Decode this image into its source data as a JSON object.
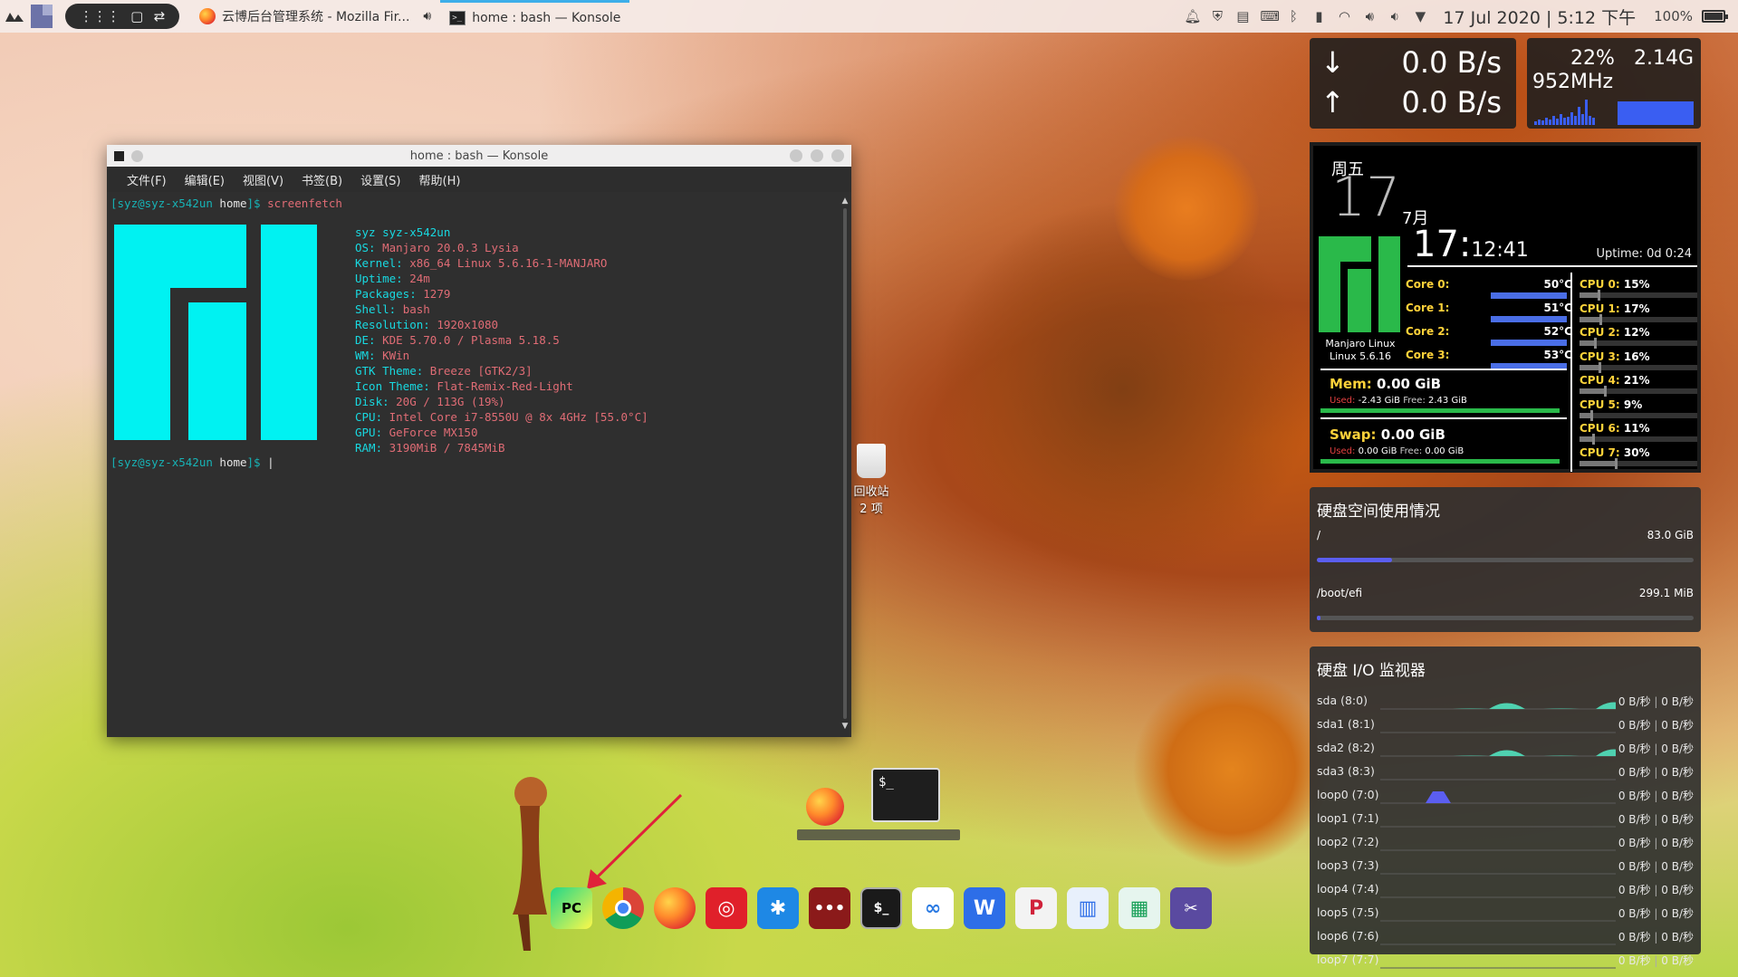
{
  "panel": {
    "tasks": [
      {
        "title": "云博后台管理系统 - Mozilla Fir...",
        "icon": "firefox-icon"
      },
      {
        "title": "home : bash — Konsole",
        "icon": "konsole-icon"
      }
    ],
    "clock": "17 Jul 2020 | 5:12 下午",
    "battery": "100%",
    "battery_level": 1.0
  },
  "konsole": {
    "title": "home : bash — Konsole",
    "menu": [
      "文件(F)",
      "编辑(E)",
      "视图(V)",
      "书签(B)",
      "设置(S)",
      "帮助(H)"
    ],
    "prompt_user": "[syz@syz-x542un",
    "prompt_dir": " home",
    "prompt_end": "]$ ",
    "command": "screenfetch",
    "info": [
      {
        "key": "",
        "val": "syz syz-x542un"
      },
      {
        "key": "OS: ",
        "val": "Manjaro 20.0.3 Lysia"
      },
      {
        "key": "Kernel: ",
        "val": "x86_64 Linux 5.6.16-1-MANJARO"
      },
      {
        "key": "Uptime: ",
        "val": "24m"
      },
      {
        "key": "Packages: ",
        "val": "1279"
      },
      {
        "key": "Shell: ",
        "val": "bash"
      },
      {
        "key": "Resolution: ",
        "val": "1920x1080"
      },
      {
        "key": "DE: ",
        "val": "KDE 5.70.0 / Plasma 5.18.5"
      },
      {
        "key": "WM: ",
        "val": "KWin"
      },
      {
        "key": "GTK Theme: ",
        "val": "Breeze [GTK2/3]"
      },
      {
        "key": "Icon Theme: ",
        "val": "Flat-Remix-Red-Light"
      },
      {
        "key": "Disk: ",
        "val": "20G / 113G (19%)"
      },
      {
        "key": "CPU: ",
        "val": "Intel Core i7-8550U @ 8x 4GHz [55.0°C]"
      },
      {
        "key": "GPU: ",
        "val": "GeForce MX150"
      },
      {
        "key": "RAM: ",
        "val": "3190MiB / 7845MiB"
      }
    ]
  },
  "desktop": {
    "trash_label": "回收站",
    "trash_count": "2 项"
  },
  "dock": {
    "items": [
      "pycharm-icon",
      "chrome-icon",
      "firefox-icon",
      "netease-music-icon",
      "xmind-icon",
      "chat-icon",
      "terminal-icon",
      "baidu-netdisk-icon",
      "wps-writer-icon",
      "wps-pdf-icon",
      "wps-doc-icon",
      "wps-sheet-icon",
      "screenshot-icon"
    ],
    "preview_terminal": "$_"
  },
  "network": {
    "down": "0.0 B/s",
    "up": "0.0 B/s"
  },
  "cpu_widget": {
    "percent": "22%",
    "memory": "2.14G",
    "freq": "952MHz"
  },
  "conky": {
    "weekday": "周五",
    "day": "17",
    "month": "7月",
    "time_hm": "17:",
    "time_min": "12",
    "time_sec": ":41",
    "uptime": "Uptime: 0d 0:24",
    "distro": "Manjaro Linux",
    "kernel": "Linux 5.6.16",
    "cores": [
      {
        "label": "Core 0:",
        "temp": "50°C"
      },
      {
        "label": "Core 1:",
        "temp": "51°C"
      },
      {
        "label": "Core 2:",
        "temp": "52°C"
      },
      {
        "label": "Core 3:",
        "temp": "53°C"
      }
    ],
    "cpus": [
      {
        "label": "CPU 0:",
        "pct": "15%",
        "v": 15
      },
      {
        "label": "CPU 1:",
        "pct": "17%",
        "v": 17
      },
      {
        "label": "CPU 2:",
        "pct": "12%",
        "v": 12
      },
      {
        "label": "CPU 3:",
        "pct": "16%",
        "v": 16
      },
      {
        "label": "CPU 4:",
        "pct": "21%",
        "v": 21
      },
      {
        "label": "CPU 5:",
        "pct": "9%",
        "v": 9
      },
      {
        "label": "CPU 6:",
        "pct": "11%",
        "v": 11
      },
      {
        "label": "CPU 7:",
        "pct": "30%",
        "v": 30
      }
    ],
    "mem_label": "Mem:",
    "mem_value": "0.00 GiB",
    "mem_used_label": "Used:",
    "mem_used": "-2.43 GiB",
    "mem_free_label": "Free:",
    "mem_free": "2.43 GiB",
    "swap_label": "Swap:",
    "swap_value": "0.00 GiB",
    "swap_used_label": "Used:",
    "swap_used": "0.00 GiB",
    "swap_free_label": "Free:",
    "swap_free": "0.00 GiB"
  },
  "disk_usage": {
    "title": "硬盘空间使用情况",
    "mounts": [
      {
        "path": "/",
        "size": "83.0 GiB",
        "fill": 0.2
      },
      {
        "path": "/boot/efi",
        "size": "299.1 MiB",
        "fill": 0.01
      }
    ]
  },
  "disk_io": {
    "title": "硬盘 I/O 监视器",
    "rows": [
      {
        "dev": "sda (8:0)",
        "read": "0 B/秒",
        "write": "0 B/秒"
      },
      {
        "dev": "sda1 (8:1)",
        "read": "0 B/秒",
        "write": "0 B/秒"
      },
      {
        "dev": "sda2 (8:2)",
        "read": "0 B/秒",
        "write": "0 B/秒"
      },
      {
        "dev": "sda3 (8:3)",
        "read": "0 B/秒",
        "write": "0 B/秒"
      },
      {
        "dev": "loop0 (7:0)",
        "read": "0 B/秒",
        "write": "0 B/秒"
      },
      {
        "dev": "loop1 (7:1)",
        "read": "0 B/秒",
        "write": "0 B/秒"
      },
      {
        "dev": "loop2 (7:2)",
        "read": "0 B/秒",
        "write": "0 B/秒"
      },
      {
        "dev": "loop3 (7:3)",
        "read": "0 B/秒",
        "write": "0 B/秒"
      },
      {
        "dev": "loop4 (7:4)",
        "read": "0 B/秒",
        "write": "0 B/秒"
      },
      {
        "dev": "loop5 (7:5)",
        "read": "0 B/秒",
        "write": "0 B/秒"
      },
      {
        "dev": "loop6 (7:6)",
        "read": "0 B/秒",
        "write": "0 B/秒"
      },
      {
        "dev": "loop7 (7:7)",
        "read": "0 B/秒",
        "write": "0 B/秒"
      }
    ]
  },
  "colors": {
    "accent": "#3daee9",
    "manjaro_cyan": "#00f2f2",
    "manjaro_green": "#2ab94a",
    "conky_yellow": "#ffd23a",
    "io_teal": "#4fd1b0",
    "io_blue": "#5b5ef0"
  }
}
